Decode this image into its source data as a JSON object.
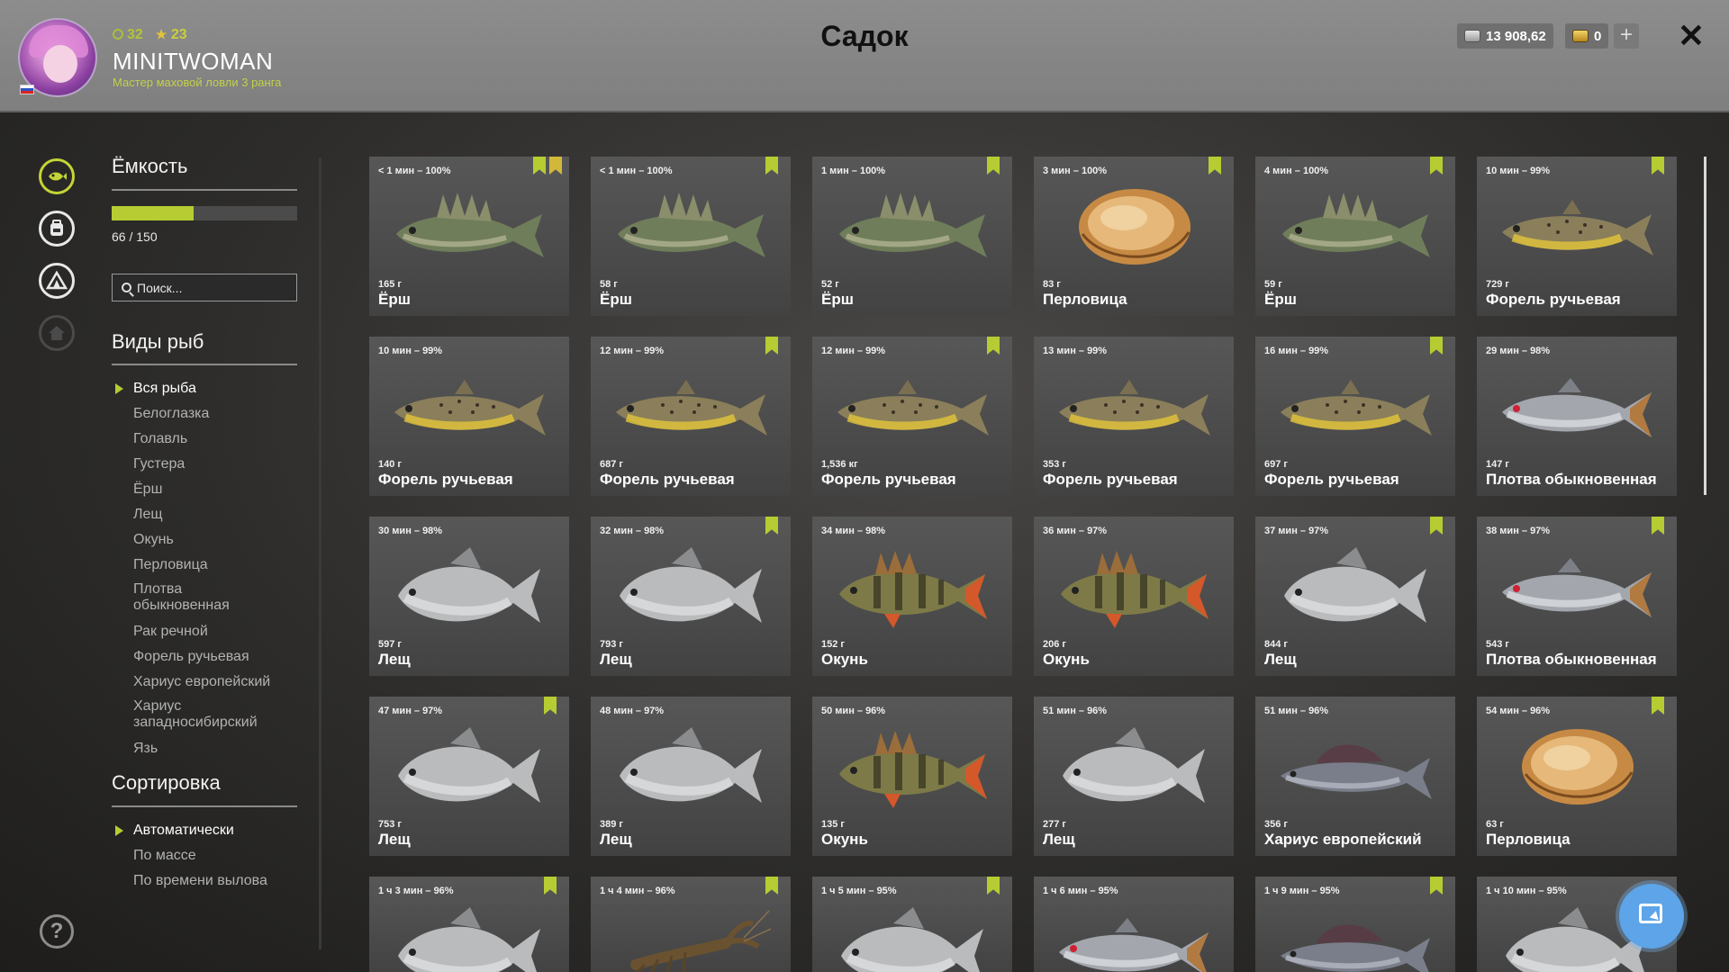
{
  "header": {
    "title": "Садок",
    "player": {
      "level": "32",
      "stars": "23",
      "nickname": "MINITWOMAN",
      "rank": "Мастер маховой ловли 3 ранга"
    },
    "silver": "13 908,62",
    "gold": "0"
  },
  "sidebar": {
    "capacity_title": "Ёмкость",
    "capacity_text": "66 / 150",
    "capacity_fraction": 0.44,
    "search_placeholder": "Поиск...",
    "species_title": "Виды рыб",
    "species": [
      "Вся рыба",
      "Белоглазка",
      "Голавль",
      "Густера",
      "Ёрш",
      "Лещ",
      "Окунь",
      "Перловица",
      "Плотва обыкновенная",
      "Рак речной",
      "Форель ручьевая",
      "Хариус европейский",
      "Хариус западносибирский",
      "Язь"
    ],
    "sort_title": "Сортировка",
    "sort_options": [
      "Автоматически",
      "По массе",
      "По времени вылова"
    ]
  },
  "colors": {
    "accent": "#b6cc32",
    "header_bg": "#8d8d8d",
    "card_bg": "#4f4f4f",
    "fab": "#5da4e8"
  },
  "cards": [
    {
      "time": "< 1 мин – 100%",
      "weight": "165 г",
      "name": "Ёрш",
      "icon": "ruffe",
      "marks": [
        "bookmark",
        "star-bookmark"
      ]
    },
    {
      "time": "< 1 мин – 100%",
      "weight": "58 г",
      "name": "Ёрш",
      "icon": "ruffe",
      "marks": [
        "bookmark"
      ]
    },
    {
      "time": "1 мин – 100%",
      "weight": "52 г",
      "name": "Ёрш",
      "icon": "ruffe",
      "marks": [
        "bookmark"
      ]
    },
    {
      "time": "3 мин – 100%",
      "weight": "83 г",
      "name": "Перловица",
      "icon": "mussel",
      "marks": [
        "bookmark"
      ]
    },
    {
      "time": "4 мин – 100%",
      "weight": "59 г",
      "name": "Ёрш",
      "icon": "ruffe",
      "marks": [
        "bookmark"
      ]
    },
    {
      "time": "10 мин – 99%",
      "weight": "729 г",
      "name": "Форель ручьевая",
      "icon": "trout",
      "marks": [
        "bookmark"
      ]
    },
    {
      "time": "10 мин – 99%",
      "weight": "140 г",
      "name": "Форель ручьевая",
      "icon": "trout",
      "marks": []
    },
    {
      "time": "12 мин – 99%",
      "weight": "687 г",
      "name": "Форель ручьевая",
      "icon": "trout",
      "marks": [
        "bookmark"
      ]
    },
    {
      "time": "12 мин – 99%",
      "weight": "1,536 кг",
      "name": "Форель ручьевая",
      "icon": "trout",
      "marks": [
        "bookmark"
      ]
    },
    {
      "time": "13 мин – 99%",
      "weight": "353 г",
      "name": "Форель ручьевая",
      "icon": "trout",
      "marks": []
    },
    {
      "time": "16 мин – 99%",
      "weight": "697 г",
      "name": "Форель ручьевая",
      "icon": "trout",
      "marks": [
        "bookmark"
      ]
    },
    {
      "time": "29 мин – 98%",
      "weight": "147 г",
      "name": "Плотва обыкновенная",
      "icon": "roach",
      "marks": []
    },
    {
      "time": "30 мин – 98%",
      "weight": "597 г",
      "name": "Лещ",
      "icon": "bream",
      "marks": []
    },
    {
      "time": "32 мин – 98%",
      "weight": "793 г",
      "name": "Лещ",
      "icon": "bream",
      "marks": [
        "bookmark"
      ]
    },
    {
      "time": "34 мин – 98%",
      "weight": "152 г",
      "name": "Окунь",
      "icon": "perch",
      "marks": []
    },
    {
      "time": "36 мин – 97%",
      "weight": "206 г",
      "name": "Окунь",
      "icon": "perch",
      "marks": []
    },
    {
      "time": "37 мин – 97%",
      "weight": "844 г",
      "name": "Лещ",
      "icon": "bream",
      "marks": [
        "bookmark"
      ]
    },
    {
      "time": "38 мин – 97%",
      "weight": "543 г",
      "name": "Плотва обыкновенная",
      "icon": "roach",
      "marks": [
        "bookmark"
      ]
    },
    {
      "time": "47 мин – 97%",
      "weight": "753 г",
      "name": "Лещ",
      "icon": "bream",
      "marks": [
        "bookmark"
      ]
    },
    {
      "time": "48 мин – 97%",
      "weight": "389 г",
      "name": "Лещ",
      "icon": "bream",
      "marks": []
    },
    {
      "time": "50 мин – 96%",
      "weight": "135 г",
      "name": "Окунь",
      "icon": "perch",
      "marks": []
    },
    {
      "time": "51 мин – 96%",
      "weight": "277 г",
      "name": "Лещ",
      "icon": "bream",
      "marks": []
    },
    {
      "time": "51 мин – 96%",
      "weight": "356 г",
      "name": "Хариус европейский",
      "icon": "grayling",
      "marks": []
    },
    {
      "time": "54 мин – 96%",
      "weight": "63 г",
      "name": "Перловица",
      "icon": "mussel",
      "marks": [
        "bookmark"
      ]
    },
    {
      "time": "1 ч 3 мин – 96%",
      "weight": "",
      "name": "",
      "icon": "bream",
      "marks": [
        "bookmark"
      ]
    },
    {
      "time": "1 ч 4 мин – 96%",
      "weight": "",
      "name": "",
      "icon": "crayfish",
      "marks": [
        "bookmark"
      ]
    },
    {
      "time": "1 ч 5 мин – 95%",
      "weight": "",
      "name": "",
      "icon": "bream",
      "marks": [
        "bookmark"
      ]
    },
    {
      "time": "1 ч 6 мин – 95%",
      "weight": "",
      "name": "",
      "icon": "roach",
      "marks": []
    },
    {
      "time": "1 ч 9 мин – 95%",
      "weight": "",
      "name": "",
      "icon": "grayling",
      "marks": [
        "bookmark"
      ]
    },
    {
      "time": "1 ч 10 мин – 95%",
      "weight": "",
      "name": "",
      "icon": "bream",
      "marks": []
    }
  ]
}
